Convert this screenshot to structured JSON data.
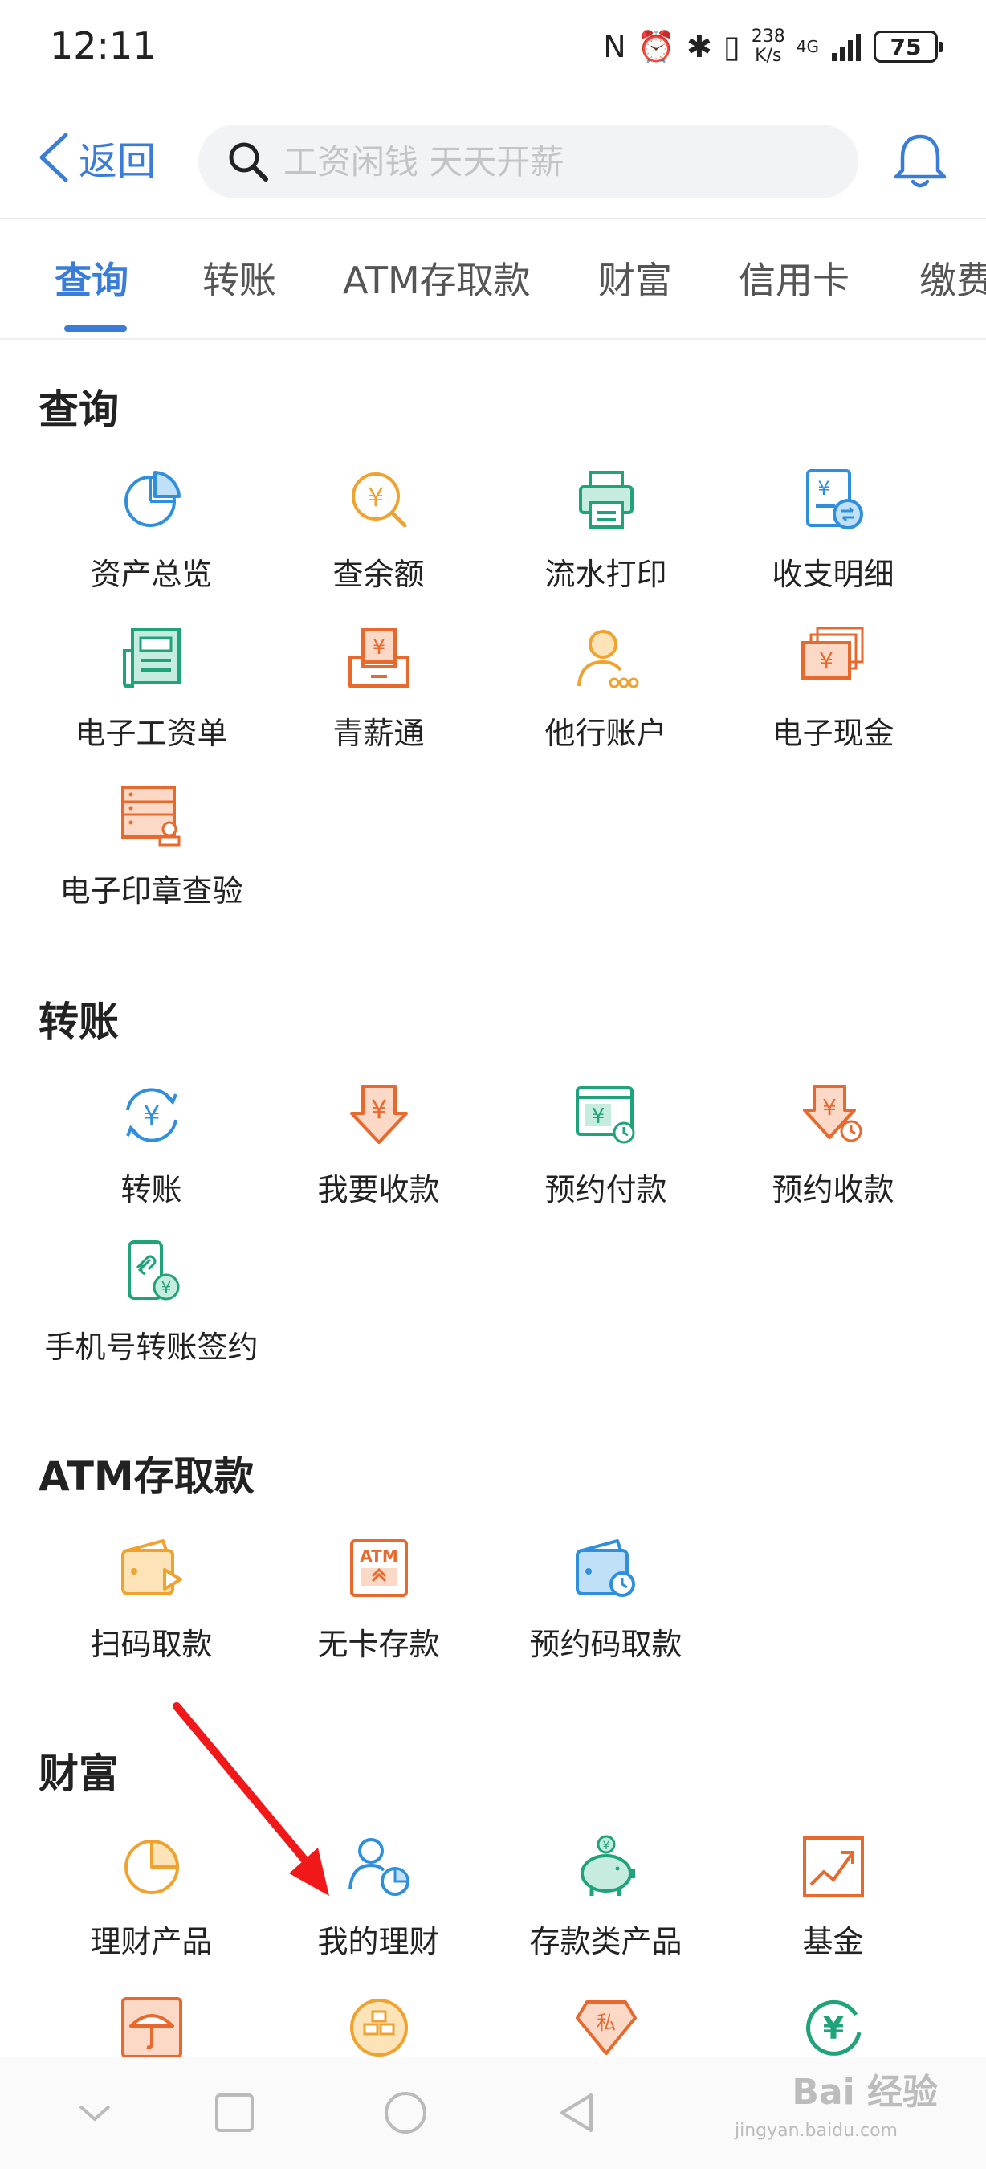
{
  "status_bar": {
    "time": "12:11",
    "net_speed_top": "238",
    "net_speed_bottom": "K/s",
    "network_gen": "4G",
    "battery": "75",
    "icons": [
      "nfc-icon",
      "alarm-icon",
      "bluetooth-icon",
      "vibrate-icon",
      "signal-icon"
    ]
  },
  "header": {
    "back_label": "返回",
    "search_placeholder": "工资闲钱 天天开薪"
  },
  "tabs": [
    {
      "label": "查询",
      "active": true
    },
    {
      "label": "转账",
      "active": false
    },
    {
      "label": "ATM存取款",
      "active": false
    },
    {
      "label": "财富",
      "active": false
    },
    {
      "label": "信用卡",
      "active": false
    },
    {
      "label": "缴费",
      "active": false
    }
  ],
  "sections": {
    "query": {
      "title": "查询",
      "items": [
        {
          "label": "资产总览",
          "icon": "pie-chart-icon",
          "color": "#2f8fdd"
        },
        {
          "label": "查余额",
          "icon": "balance-search-icon",
          "color": "#f0a22e"
        },
        {
          "label": "流水打印",
          "icon": "printer-icon",
          "color": "#1fa37a"
        },
        {
          "label": "收支明细",
          "icon": "statement-icon",
          "color": "#2f8fdd"
        },
        {
          "label": "电子工资单",
          "icon": "payslip-icon",
          "color": "#1fa37a"
        },
        {
          "label": "青薪通",
          "icon": "inbox-yuan-icon",
          "color": "#e8692d"
        },
        {
          "label": "他行账户",
          "icon": "user-account-icon",
          "color": "#f0a22e"
        },
        {
          "label": "电子现金",
          "icon": "cash-cards-icon",
          "color": "#e8692d"
        },
        {
          "label": "电子印章查验",
          "icon": "seal-check-icon",
          "color": "#e8692d"
        }
      ]
    },
    "transfer": {
      "title": "转账",
      "items": [
        {
          "label": "转账",
          "icon": "transfer-cycle-icon",
          "color": "#2f8fdd"
        },
        {
          "label": "我要收款",
          "icon": "receive-money-icon",
          "color": "#e8692d"
        },
        {
          "label": "预约付款",
          "icon": "scheduled-pay-icon",
          "color": "#1fa37a"
        },
        {
          "label": "预约收款",
          "icon": "scheduled-receive-icon",
          "color": "#e8692d"
        },
        {
          "label": "手机号转账签约",
          "icon": "phone-transfer-icon",
          "color": "#1fa37a"
        }
      ]
    },
    "atm": {
      "title": "ATM存取款",
      "items": [
        {
          "label": "扫码取款",
          "icon": "scan-wallet-icon",
          "color": "#f0a22e"
        },
        {
          "label": "无卡存款",
          "icon": "atm-icon",
          "color": "#e8692d"
        },
        {
          "label": "预约码取款",
          "icon": "wallet-clock-icon",
          "color": "#2f8fdd"
        }
      ]
    },
    "wealth": {
      "title": "财富",
      "items": [
        {
          "label": "理财产品",
          "icon": "pie-product-icon",
          "color": "#f0a22e"
        },
        {
          "label": "我的理财",
          "icon": "user-pie-icon",
          "color": "#2f8fdd"
        },
        {
          "label": "存款类产品",
          "icon": "piggy-bank-icon",
          "color": "#1fa37a"
        },
        {
          "label": "基金",
          "icon": "fund-chart-icon",
          "color": "#e8692d"
        },
        {
          "label": "",
          "icon": "umbrella-icon",
          "color": "#e8692d"
        },
        {
          "label": "",
          "icon": "gold-icon",
          "color": "#f0a22e"
        },
        {
          "label": "",
          "icon": "private-diamond-icon",
          "color": "#e8692d"
        },
        {
          "label": "",
          "icon": "yuan-cycle-icon",
          "color": "#1fa37a"
        }
      ]
    }
  },
  "watermark": {
    "brand": "Bai 经验",
    "url": "jingyan.baidu.com"
  }
}
